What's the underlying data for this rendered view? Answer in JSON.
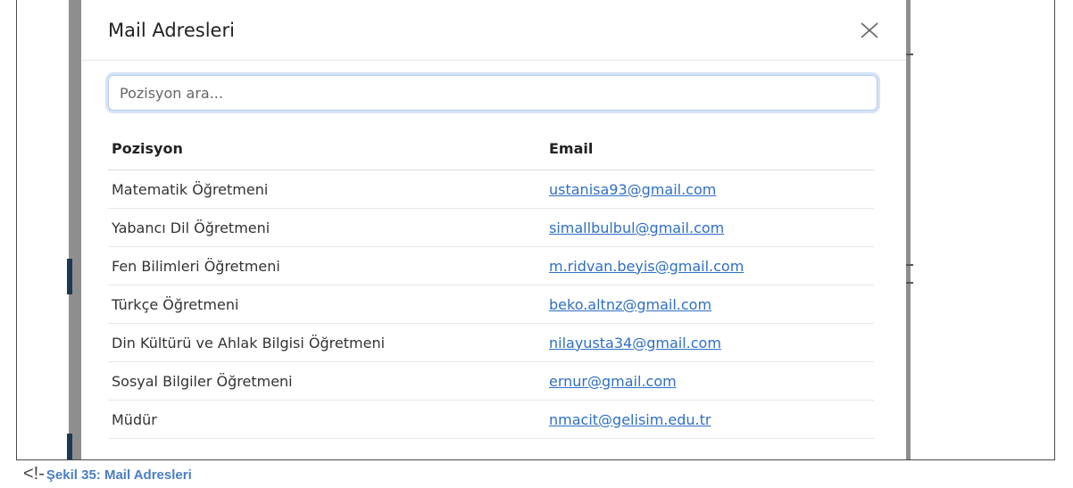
{
  "modal": {
    "title": "Mail Adresleri",
    "close_icon": "close-icon"
  },
  "search": {
    "placeholder": "Pozisyon ara...",
    "value": ""
  },
  "table": {
    "headers": {
      "position": "Pozisyon",
      "email": "Email"
    },
    "rows": [
      {
        "position": "Matematik Öğretmeni",
        "email": "ustanisa93@gmail.com"
      },
      {
        "position": "Yabancı Dil Öğretmeni",
        "email": "simallbulbul@gmail.com"
      },
      {
        "position": "Fen Bilimleri Öğretmeni",
        "email": "m.ridvan.beyis@gmail.com"
      },
      {
        "position": "Türkçe Öğretmeni",
        "email": "beko.altnz@gmail.com"
      },
      {
        "position": "Din Kültürü ve Ahlak Bilgisi Öğretmeni",
        "email": "nilayusta34@gmail.com"
      },
      {
        "position": "Sosyal Bilgiler Öğretmeni",
        "email": "ernur@gmail.com"
      },
      {
        "position": "Müdür",
        "email": "nmacit@gelisim.edu.tr"
      }
    ]
  },
  "caption": {
    "marker": "<!-",
    "text": "Şekil 35: Mail Adresleri"
  },
  "colors": {
    "link": "#2f6fc4",
    "caption": "#4a7ec4",
    "search_focus": "#d6e4f7"
  }
}
